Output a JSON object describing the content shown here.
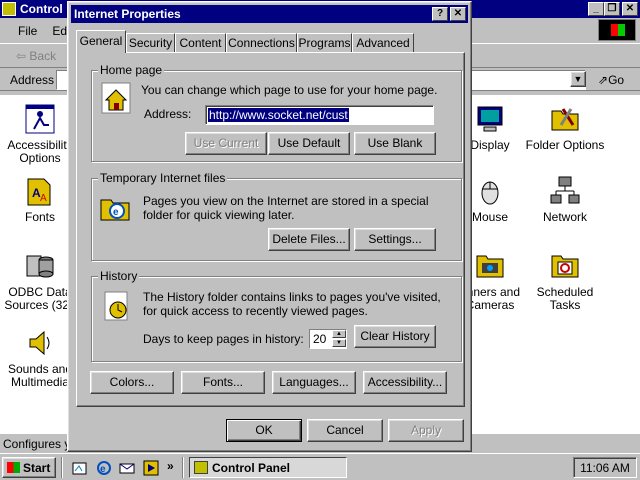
{
  "control_panel": {
    "title": "Control",
    "menu": [
      "File",
      "Edi"
    ],
    "back_label": "Back",
    "address_label": "Address",
    "go_label": "Go",
    "status_text": "Configures yo",
    "icons_left": [
      {
        "name": "accessibility",
        "label": "Accessibility Options"
      },
      {
        "name": "fonts",
        "label": "Fonts"
      },
      {
        "name": "odbc",
        "label": "ODBC Data Sources (32b"
      },
      {
        "name": "sounds",
        "label": "Sounds and Multimedia"
      }
    ],
    "icons_right": [
      {
        "name": "display",
        "label": "Display"
      },
      {
        "name": "folder-options",
        "label": "Folder Options"
      },
      {
        "name": "mouse",
        "label": "Mouse"
      },
      {
        "name": "network",
        "label": "Network"
      },
      {
        "name": "scanners",
        "label": "anners and Cameras"
      },
      {
        "name": "scheduled-tasks",
        "label": "Scheduled Tasks"
      }
    ]
  },
  "dialog": {
    "title": "Internet Properties",
    "help_btn": "?",
    "close_btn": "✕",
    "tabs": [
      "General",
      "Security",
      "Content",
      "Connections",
      "Programs",
      "Advanced"
    ],
    "home": {
      "group_label": "Home page",
      "description": "You can change which page to use for your home page.",
      "address_label": "Address:",
      "address_value": "http://www.socket.net/cust",
      "use_current": "Use Current",
      "use_default": "Use Default",
      "use_blank": "Use Blank"
    },
    "temp": {
      "group_label": "Temporary Internet files",
      "description": "Pages you view on the Internet are stored in a special folder for quick viewing later.",
      "delete_files": "Delete Files...",
      "settings": "Settings..."
    },
    "history": {
      "group_label": "History",
      "description": "The History folder contains links to pages you've visited, for quick access to recently viewed pages.",
      "days_label": "Days to keep pages in history:",
      "days_value": "20",
      "clear_history": "Clear History"
    },
    "bottom_buttons": {
      "colors": "Colors...",
      "fonts": "Fonts...",
      "languages": "Languages...",
      "accessibility": "Accessibility..."
    },
    "ok": "OK",
    "cancel": "Cancel",
    "apply": "Apply"
  },
  "taskbar": {
    "start": "Start",
    "chevron": "»",
    "task_label": "Control Panel",
    "clock": "11:06 AM"
  }
}
